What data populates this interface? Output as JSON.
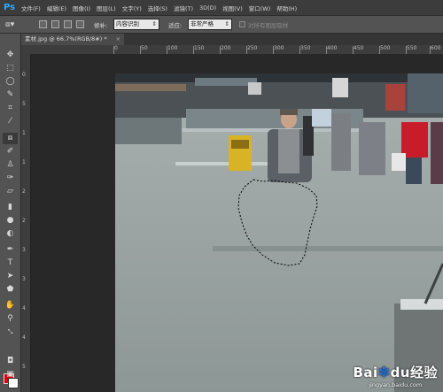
{
  "app": {
    "logo": "Ps"
  },
  "menu": [
    "文件(F)",
    "编辑(E)",
    "图像(I)",
    "图层(L)",
    "文字(Y)",
    "选择(S)",
    "滤镜(T)",
    "3D(D)",
    "视图(V)",
    "窗口(W)",
    "帮助(H)"
  ],
  "options": {
    "patch_label": "修补:",
    "patch_value": "内容识别",
    "adapt_label": "适应:",
    "adapt_value": "非常严格",
    "sample_all_label": "对所有图层取样"
  },
  "document": {
    "tab_title": "素材.jpg @ 66.7%(RGB/8#) *",
    "close_symbol": "×"
  },
  "ruler": {
    "top": [
      "0",
      "50",
      "100",
      "150",
      "200",
      "250",
      "300",
      "350",
      "400",
      "450",
      "500",
      "550",
      "600"
    ],
    "left": [
      "0",
      "5",
      "1",
      "1",
      "2",
      "2",
      "3",
      "3",
      "4",
      "4",
      "5"
    ]
  },
  "colors": {
    "foreground": "#e0000b",
    "background": "#ffffff",
    "accent": "#31a8ff"
  },
  "watermark": {
    "logo_a": "Bai",
    "logo_b": "du",
    "logo_c": "经验",
    "url": "jingyan.baidu.com"
  },
  "tools": [
    "move-tool",
    "marquee-tool",
    "lasso-tool",
    "quick-selection-tool",
    "crop-tool",
    "eyedropper-tool",
    "patch-tool",
    "brush-tool",
    "clone-stamp-tool",
    "history-brush-tool",
    "eraser-tool",
    "gradient-tool",
    "blur-tool",
    "dodge-tool",
    "pen-tool",
    "type-tool",
    "path-selection-tool",
    "shape-tool",
    "hand-tool",
    "zoom-tool"
  ]
}
